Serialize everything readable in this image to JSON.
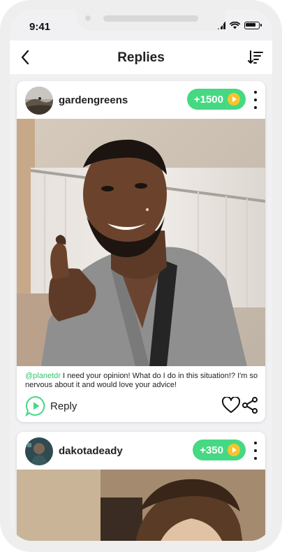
{
  "status": {
    "time": "9:41"
  },
  "header": {
    "title": "Replies"
  },
  "posts": [
    {
      "username": "gardengreens",
      "points": "+1500",
      "mention": "@planetdr",
      "text": " I need your opinion! What do I do in this situation!? I'm so nervous about it and would love your advice!",
      "reply_label": "Reply"
    },
    {
      "username": "dakotadeady",
      "points": "+350"
    }
  ],
  "colors": {
    "accent": "#46d882",
    "coin": "#f7c42d",
    "mention": "#35c46f"
  }
}
